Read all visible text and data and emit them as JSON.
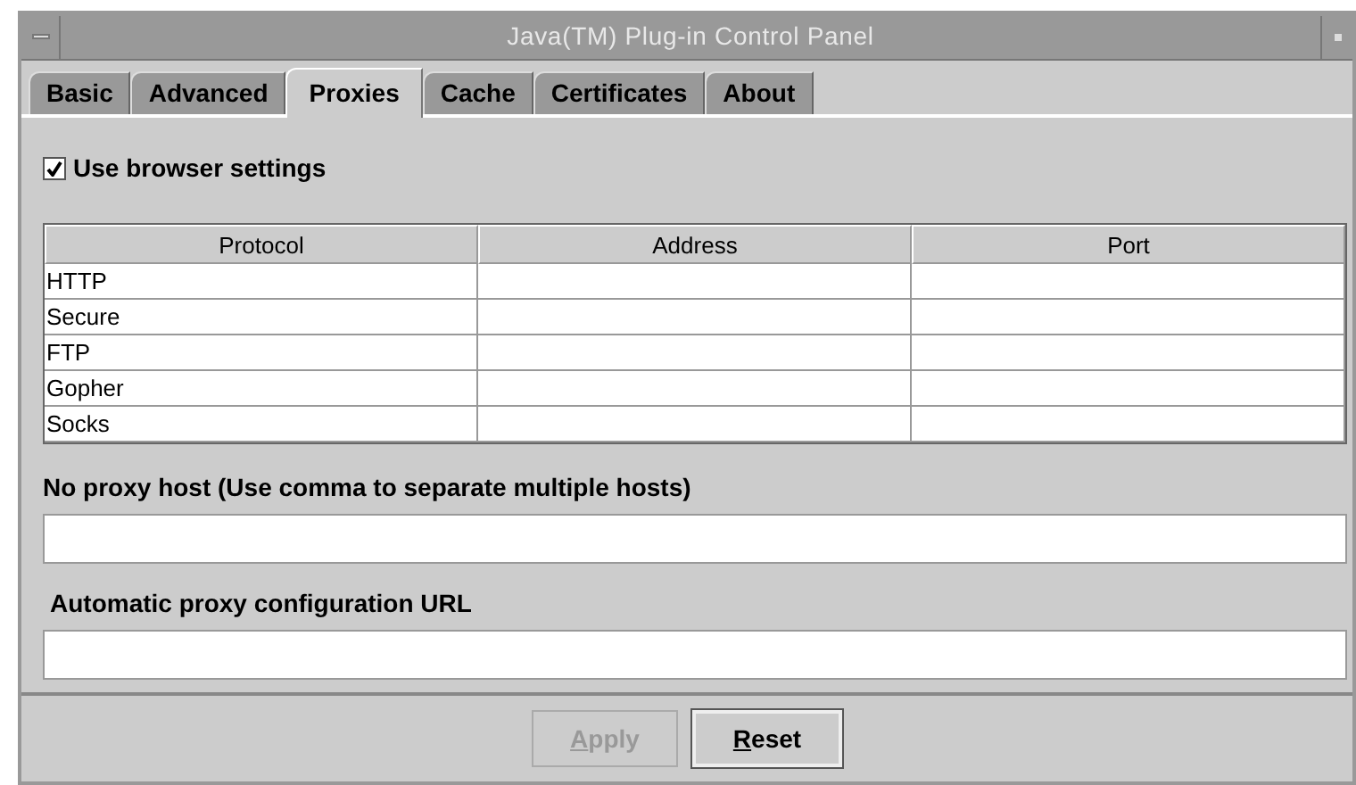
{
  "window": {
    "title": "Java(TM) Plug-in Control Panel"
  },
  "tabs": [
    {
      "label": "Basic",
      "selected": false
    },
    {
      "label": "Advanced",
      "selected": false
    },
    {
      "label": "Proxies",
      "selected": true
    },
    {
      "label": "Cache",
      "selected": false
    },
    {
      "label": "Certificates",
      "selected": false
    },
    {
      "label": "About",
      "selected": false
    }
  ],
  "use_browser_settings": {
    "label": "Use browser settings",
    "checked": true
  },
  "table": {
    "columns": [
      "Protocol",
      "Address",
      "Port"
    ],
    "rows": [
      [
        "HTTP"
      ],
      [
        "Secure"
      ],
      [
        "FTP"
      ],
      [
        "Gopher"
      ],
      [
        "Socks"
      ]
    ]
  },
  "no_proxy_host": {
    "label": "No proxy host (Use comma to separate multiple hosts)"
  },
  "auto_config_url": {
    "label": "Automatic proxy configuration URL"
  },
  "buttons": [
    {
      "label": "Apply",
      "mnemonic_underlined": true,
      "disabled": true
    },
    {
      "label": "Reset",
      "mnemonic_underlined": true,
      "disabled": false
    }
  ]
}
